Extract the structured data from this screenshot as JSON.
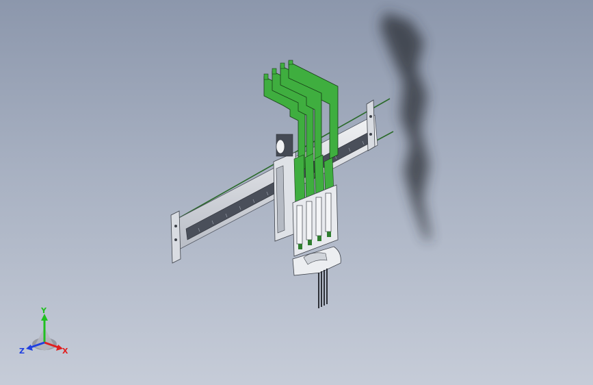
{
  "viewport": {
    "background_top": "#8c97ac",
    "background_bottom": "#c6ccd8"
  },
  "model": {
    "board_color": "#3fae3f",
    "frame_color": "#e6e8ec",
    "shadow_color": "#2c2f36"
  },
  "triad": {
    "x_label": "X",
    "y_label": "Y",
    "z_label": "Z",
    "x_color": "#e02020",
    "y_color": "#20c020",
    "z_color": "#2040e0"
  }
}
